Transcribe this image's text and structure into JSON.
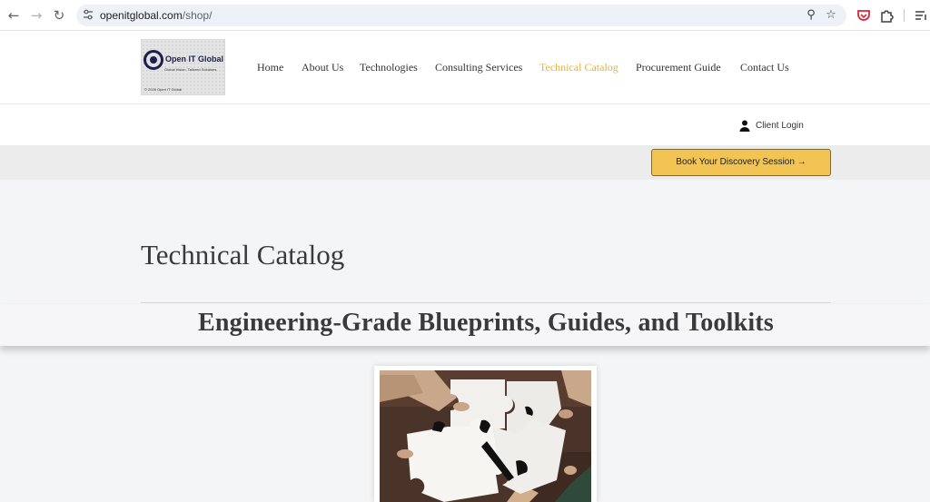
{
  "browser": {
    "url_domain": "openitglobal.com",
    "url_path": "/shop/"
  },
  "logo": {
    "brand": "Open IT Global",
    "tagline": "Global Vision. Tailored Solutions.",
    "copyright": "© 2026 Open IT Global"
  },
  "nav": {
    "items": [
      "Home",
      "About Us",
      "Technologies",
      "Consulting Services",
      "Technical Catalog",
      "Procurement Guide",
      "Contact Us"
    ],
    "active": "Technical Catalog"
  },
  "sub_header": {
    "client_login": "Client Login"
  },
  "cta": {
    "label": "Book Your Discovery Session →"
  },
  "page": {
    "title": "Technical Catalog",
    "subtitle": "Engineering-Grade Blueprints, Guides, and Toolkits"
  },
  "icons": {
    "back": "back-arrow-icon",
    "forward": "forward-arrow-icon",
    "reload": "reload-icon",
    "site_info": "site-info-icon",
    "zoom": "zoom-icon",
    "bookmark": "star-icon",
    "extension_pocket": "pocket-icon",
    "extensions": "puzzle-icon",
    "reading_list": "reading-list-icon",
    "user": "user-icon"
  },
  "colors": {
    "accent": "#e2b23c",
    "cta_bg": "#f1c453",
    "brand_navy": "#1d1f4e"
  }
}
